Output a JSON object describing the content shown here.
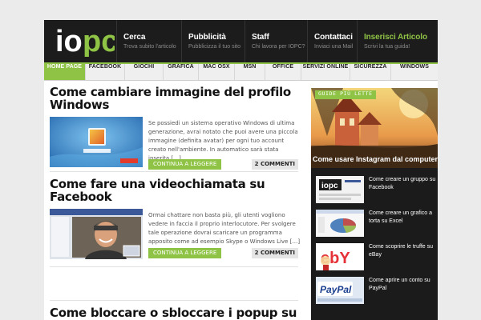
{
  "logo": {
    "io": "io",
    "pc": "pc"
  },
  "topnav": [
    {
      "title": "Cerca",
      "subtitle": "Trova subito l'articolo"
    },
    {
      "title": "Pubblicità",
      "subtitle": "Pubblicizza il tuo sito"
    },
    {
      "title": "Staff",
      "subtitle": "Chi lavora per IOPC?"
    },
    {
      "title": "Contattaci",
      "subtitle": "Inviaci una Mail"
    },
    {
      "title": "Inserisci Articolo",
      "subtitle": "Scrivi la tua guida!"
    }
  ],
  "categories": [
    "HOME PAGE",
    "FACEBOOK",
    "GIOCHI",
    "GRAFICA",
    "MAC OSX",
    "MSN",
    "OFFICE",
    "SERVIZI ONLINE",
    "SICUREZZA",
    "WINDOWS"
  ],
  "posts": [
    {
      "title": "Come cambiare immagine del profilo Windows",
      "excerpt": "Se possiedi un sistema operativo Windows di ultima generazione, avrai notato che puoi avere una piccola immagine (definita avatar) per ogni tuo account creato nell'ambiente. In automatico sarà stata inserita […]",
      "readmore": "CONTINUA A LEGGERE",
      "comments": "2 COMMENTI"
    },
    {
      "title": "Come fare una videochiamata su Facebook",
      "excerpt": "Ormai chattare non basta più, gli utenti vogliono vedere in faccia il proprio interlocutore. Per svolgere tale operazione dovrai scaricare un programma apposito come ad esempio Skype o Windows Live […]",
      "readmore": "CONTINUA A LEGGERE",
      "comments": "2 COMMENTI"
    },
    {
      "title": "Come bloccare o sbloccare i popup su"
    }
  ],
  "sidebar": {
    "badge": "GUIDE PIÙ LETTE",
    "featured_title": "Come usare Instagram dal computer",
    "items": [
      {
        "text": "Come creare un gruppo su Facebook",
        "thumb_text": "iopc"
      },
      {
        "text": "Come creare un grafico a torta su Excel"
      },
      {
        "text": "Come scoprire le truffe su eBay",
        "thumb_text": "ebY"
      },
      {
        "text": "Come aprire un conto su PayPal",
        "thumb_text": "PayPal"
      }
    ]
  },
  "colors": {
    "accent": "#8fc345",
    "header_bg": "#1c1c1c",
    "page_bg": "#ebebeb"
  }
}
